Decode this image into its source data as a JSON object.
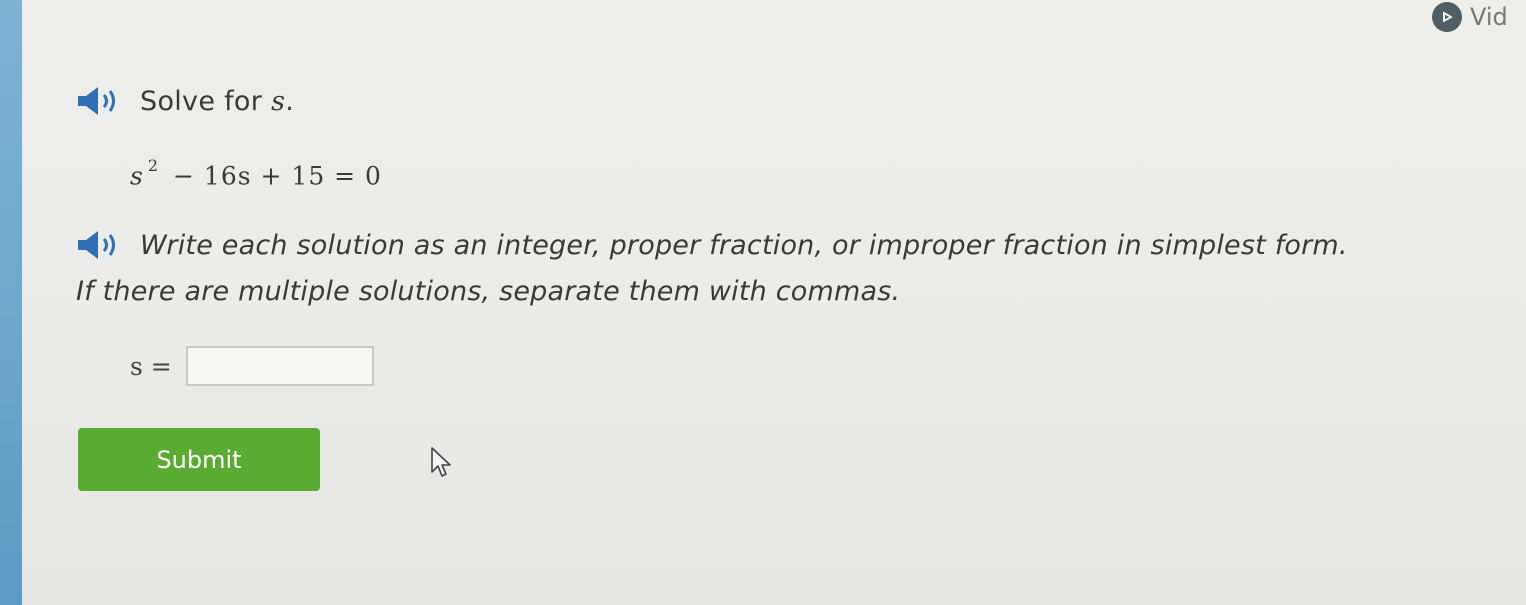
{
  "header": {
    "video_label": "Vid"
  },
  "question": {
    "prompt_prefix": "Solve for",
    "prompt_variable": "s",
    "prompt_suffix": ".",
    "equation": {
      "base": "s",
      "exponent": "2",
      "rest": "− 16s + 15 = 0"
    },
    "instruction_line1": "Write each solution as an integer, proper fraction, or improper fraction in simplest form.",
    "instruction_line2": "If there are multiple solutions, separate them with commas."
  },
  "answer": {
    "label": "s =",
    "value": "",
    "placeholder": ""
  },
  "submit_label": "Submit",
  "colors": {
    "submit_green": "#5aab31",
    "speaker_blue": "#2e6fb5",
    "left_strip_blue": "#6aa6cc"
  },
  "icons": [
    "play-icon",
    "speaker-icon",
    "mouse-pointer-icon"
  ]
}
